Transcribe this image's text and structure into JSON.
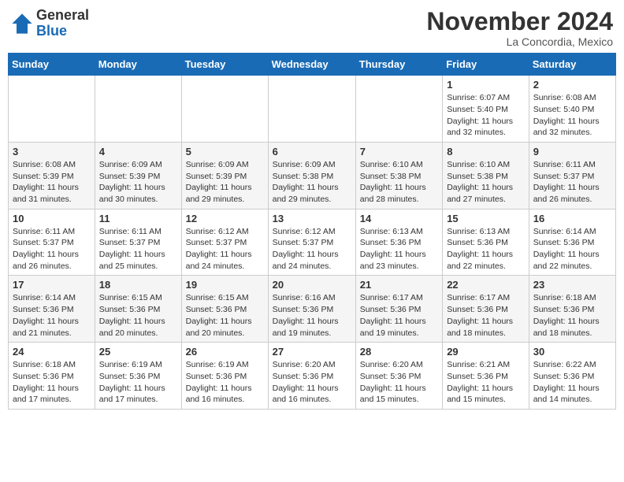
{
  "header": {
    "logo_general": "General",
    "logo_blue": "Blue",
    "month_title": "November 2024",
    "location": "La Concordia, Mexico"
  },
  "weekdays": [
    "Sunday",
    "Monday",
    "Tuesday",
    "Wednesday",
    "Thursday",
    "Friday",
    "Saturday"
  ],
  "weeks": [
    [
      {
        "day": "",
        "info": ""
      },
      {
        "day": "",
        "info": ""
      },
      {
        "day": "",
        "info": ""
      },
      {
        "day": "",
        "info": ""
      },
      {
        "day": "",
        "info": ""
      },
      {
        "day": "1",
        "info": "Sunrise: 6:07 AM\nSunset: 5:40 PM\nDaylight: 11 hours and 32 minutes."
      },
      {
        "day": "2",
        "info": "Sunrise: 6:08 AM\nSunset: 5:40 PM\nDaylight: 11 hours and 32 minutes."
      }
    ],
    [
      {
        "day": "3",
        "info": "Sunrise: 6:08 AM\nSunset: 5:39 PM\nDaylight: 11 hours and 31 minutes."
      },
      {
        "day": "4",
        "info": "Sunrise: 6:09 AM\nSunset: 5:39 PM\nDaylight: 11 hours and 30 minutes."
      },
      {
        "day": "5",
        "info": "Sunrise: 6:09 AM\nSunset: 5:39 PM\nDaylight: 11 hours and 29 minutes."
      },
      {
        "day": "6",
        "info": "Sunrise: 6:09 AM\nSunset: 5:38 PM\nDaylight: 11 hours and 29 minutes."
      },
      {
        "day": "7",
        "info": "Sunrise: 6:10 AM\nSunset: 5:38 PM\nDaylight: 11 hours and 28 minutes."
      },
      {
        "day": "8",
        "info": "Sunrise: 6:10 AM\nSunset: 5:38 PM\nDaylight: 11 hours and 27 minutes."
      },
      {
        "day": "9",
        "info": "Sunrise: 6:11 AM\nSunset: 5:37 PM\nDaylight: 11 hours and 26 minutes."
      }
    ],
    [
      {
        "day": "10",
        "info": "Sunrise: 6:11 AM\nSunset: 5:37 PM\nDaylight: 11 hours and 26 minutes."
      },
      {
        "day": "11",
        "info": "Sunrise: 6:11 AM\nSunset: 5:37 PM\nDaylight: 11 hours and 25 minutes."
      },
      {
        "day": "12",
        "info": "Sunrise: 6:12 AM\nSunset: 5:37 PM\nDaylight: 11 hours and 24 minutes."
      },
      {
        "day": "13",
        "info": "Sunrise: 6:12 AM\nSunset: 5:37 PM\nDaylight: 11 hours and 24 minutes."
      },
      {
        "day": "14",
        "info": "Sunrise: 6:13 AM\nSunset: 5:36 PM\nDaylight: 11 hours and 23 minutes."
      },
      {
        "day": "15",
        "info": "Sunrise: 6:13 AM\nSunset: 5:36 PM\nDaylight: 11 hours and 22 minutes."
      },
      {
        "day": "16",
        "info": "Sunrise: 6:14 AM\nSunset: 5:36 PM\nDaylight: 11 hours and 22 minutes."
      }
    ],
    [
      {
        "day": "17",
        "info": "Sunrise: 6:14 AM\nSunset: 5:36 PM\nDaylight: 11 hours and 21 minutes."
      },
      {
        "day": "18",
        "info": "Sunrise: 6:15 AM\nSunset: 5:36 PM\nDaylight: 11 hours and 20 minutes."
      },
      {
        "day": "19",
        "info": "Sunrise: 6:15 AM\nSunset: 5:36 PM\nDaylight: 11 hours and 20 minutes."
      },
      {
        "day": "20",
        "info": "Sunrise: 6:16 AM\nSunset: 5:36 PM\nDaylight: 11 hours and 19 minutes."
      },
      {
        "day": "21",
        "info": "Sunrise: 6:17 AM\nSunset: 5:36 PM\nDaylight: 11 hours and 19 minutes."
      },
      {
        "day": "22",
        "info": "Sunrise: 6:17 AM\nSunset: 5:36 PM\nDaylight: 11 hours and 18 minutes."
      },
      {
        "day": "23",
        "info": "Sunrise: 6:18 AM\nSunset: 5:36 PM\nDaylight: 11 hours and 18 minutes."
      }
    ],
    [
      {
        "day": "24",
        "info": "Sunrise: 6:18 AM\nSunset: 5:36 PM\nDaylight: 11 hours and 17 minutes."
      },
      {
        "day": "25",
        "info": "Sunrise: 6:19 AM\nSunset: 5:36 PM\nDaylight: 11 hours and 17 minutes."
      },
      {
        "day": "26",
        "info": "Sunrise: 6:19 AM\nSunset: 5:36 PM\nDaylight: 11 hours and 16 minutes."
      },
      {
        "day": "27",
        "info": "Sunrise: 6:20 AM\nSunset: 5:36 PM\nDaylight: 11 hours and 16 minutes."
      },
      {
        "day": "28",
        "info": "Sunrise: 6:20 AM\nSunset: 5:36 PM\nDaylight: 11 hours and 15 minutes."
      },
      {
        "day": "29",
        "info": "Sunrise: 6:21 AM\nSunset: 5:36 PM\nDaylight: 11 hours and 15 minutes."
      },
      {
        "day": "30",
        "info": "Sunrise: 6:22 AM\nSunset: 5:36 PM\nDaylight: 11 hours and 14 minutes."
      }
    ]
  ]
}
